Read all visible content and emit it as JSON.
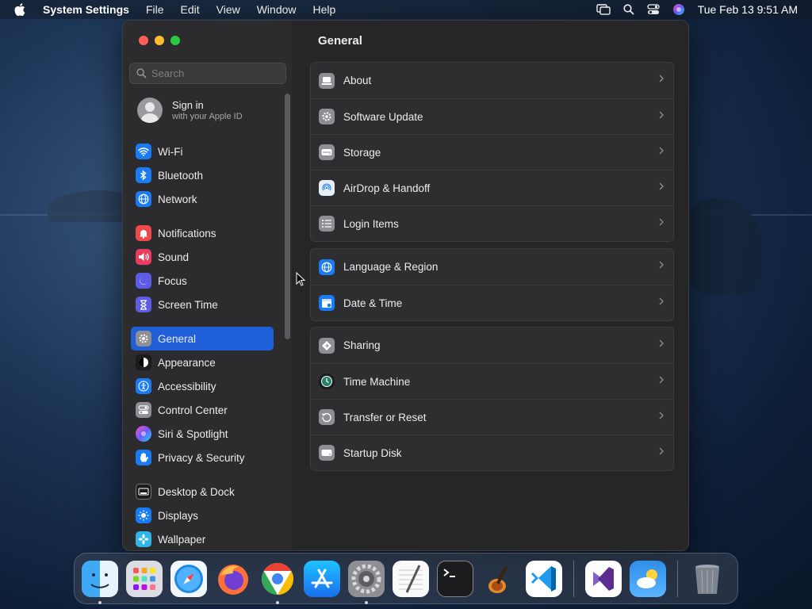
{
  "menubar": {
    "app_name": "System Settings",
    "menus": [
      "File",
      "Edit",
      "View",
      "Window",
      "Help"
    ],
    "clock": "Tue Feb 13  9:51 AM"
  },
  "sidebar": {
    "search_placeholder": "Search",
    "account": {
      "name": "Sign in",
      "subtitle": "with your Apple ID"
    },
    "items": [
      {
        "label": "Wi-Fi",
        "icon": "wifi-icon",
        "color": "#1a7cf5"
      },
      {
        "label": "Bluetooth",
        "icon": "bluetooth-icon",
        "color": "#1a7cf5"
      },
      {
        "label": "Network",
        "icon": "globe-icon",
        "color": "#1a7cf5"
      },
      {
        "label": "Notifications",
        "icon": "bell-icon",
        "color": "#ef4a4a"
      },
      {
        "label": "Sound",
        "icon": "speaker-icon",
        "color": "#ea3b60"
      },
      {
        "label": "Focus",
        "icon": "moon-icon",
        "color": "#5e5ce6"
      },
      {
        "label": "Screen Time",
        "icon": "hourglass-icon",
        "color": "#5e5ce6"
      },
      {
        "label": "General",
        "icon": "gear-icon",
        "color": "#8e8e93",
        "active": true
      },
      {
        "label": "Appearance",
        "icon": "appearance-icon",
        "color": "#1c1c1e"
      },
      {
        "label": "Accessibility",
        "icon": "accessibility-icon",
        "color": "#1a7cf5"
      },
      {
        "label": "Control Center",
        "icon": "control-center-icon",
        "color": "#8e8e93"
      },
      {
        "label": "Siri & Spotlight",
        "icon": "siri-icon",
        "color": "#a23ad6"
      },
      {
        "label": "Privacy & Security",
        "icon": "hand-icon",
        "color": "#1a7cf5"
      },
      {
        "label": "Desktop & Dock",
        "icon": "dock-icon",
        "color": "#1c1c1e"
      },
      {
        "label": "Displays",
        "icon": "sun-icon",
        "color": "#1a7cf5"
      },
      {
        "label": "Wallpaper",
        "icon": "flower-icon",
        "color": "#2fb5e8"
      }
    ]
  },
  "content": {
    "title": "General",
    "groups": [
      [
        {
          "label": "About",
          "icon": "laptop-icon",
          "color": "#8e8e93"
        },
        {
          "label": "Software Update",
          "icon": "gear-badge-icon",
          "color": "#8e8e93"
        },
        {
          "label": "Storage",
          "icon": "drive-icon",
          "color": "#8e8e93"
        },
        {
          "label": "AirDrop & Handoff",
          "icon": "airdrop-icon",
          "color": "#e8eef8"
        },
        {
          "label": "Login Items",
          "icon": "list-icon",
          "color": "#8e8e93"
        }
      ],
      [
        {
          "label": "Language & Region",
          "icon": "globe-icon",
          "color": "#1a7cf5"
        },
        {
          "label": "Date & Time",
          "icon": "calendar-icon",
          "color": "#1a7cf5"
        }
      ],
      [
        {
          "label": "Sharing",
          "icon": "sharing-icon",
          "color": "#8e8e93"
        },
        {
          "label": "Time Machine",
          "icon": "time-machine-icon",
          "color": "#1c1c1e"
        },
        {
          "label": "Transfer or Reset",
          "icon": "reset-icon",
          "color": "#8e8e93"
        },
        {
          "label": "Startup Disk",
          "icon": "disk-icon",
          "color": "#8e8e93"
        }
      ]
    ]
  },
  "dock": [
    {
      "name": "Finder",
      "icon": "finder-icon",
      "running": true
    },
    {
      "name": "Launchpad",
      "icon": "launchpad-icon",
      "running": false
    },
    {
      "name": "Safari",
      "icon": "safari-icon",
      "running": false
    },
    {
      "name": "Firefox",
      "icon": "firefox-icon",
      "running": false
    },
    {
      "name": "Chrome",
      "icon": "chrome-icon",
      "running": true
    },
    {
      "name": "App Store",
      "icon": "app-store-icon",
      "running": false
    },
    {
      "name": "System Settings",
      "icon": "system-settings-icon",
      "running": true
    },
    {
      "name": "TextEdit",
      "icon": "textedit-icon",
      "running": false
    },
    {
      "name": "Terminal",
      "icon": "terminal-icon",
      "running": false
    },
    {
      "name": "GarageBand",
      "icon": "garageband-icon",
      "running": false
    },
    {
      "name": "VS Code",
      "icon": "vscode-icon",
      "running": false
    },
    {
      "name": "Visual Studio",
      "icon": "visual-studio-icon",
      "running": false
    },
    {
      "name": "Weather",
      "icon": "weather-icon",
      "running": false
    },
    {
      "name": "Trash",
      "icon": "trash-icon",
      "running": false
    }
  ]
}
